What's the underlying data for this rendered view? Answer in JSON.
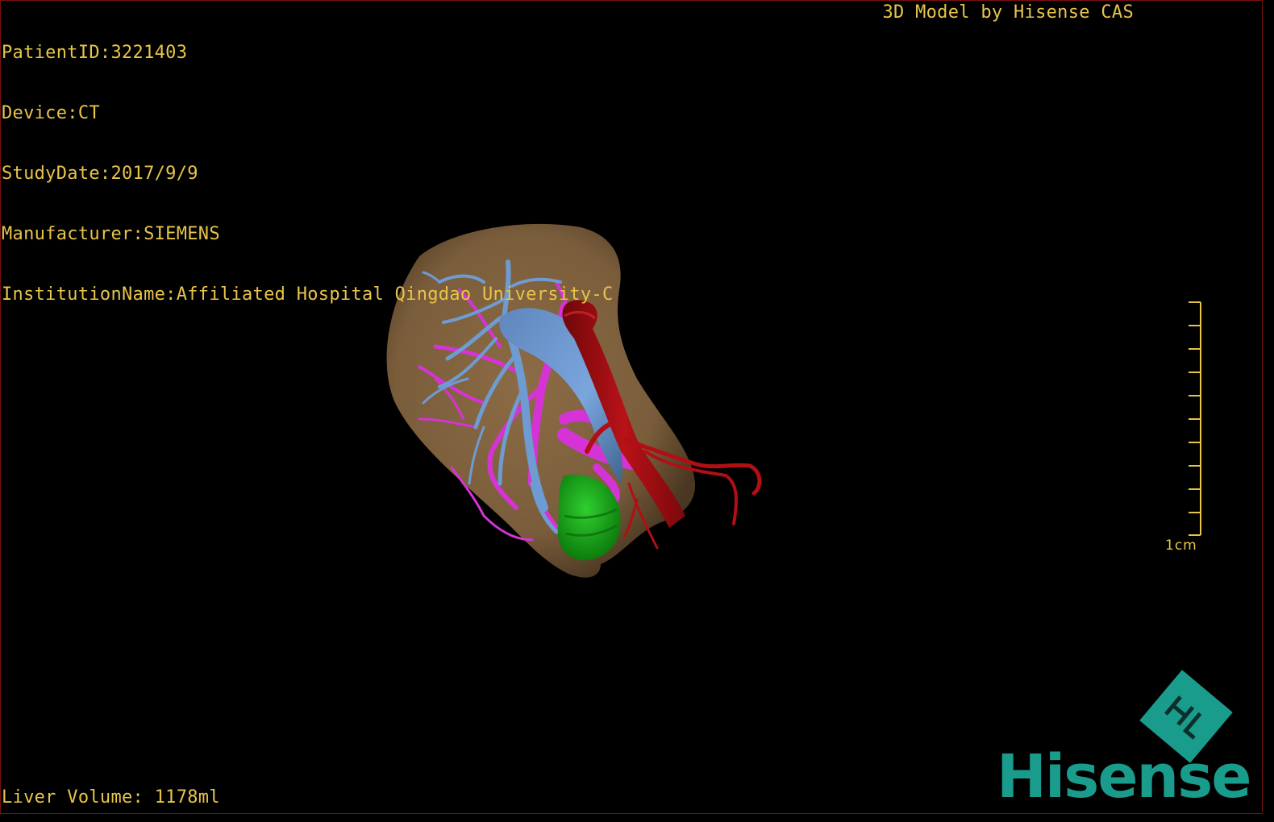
{
  "dicom_info": {
    "patient_id": "PatientID:3221403",
    "device": "Device:CT",
    "study_date": "StudyDate:2017/9/9",
    "manufacturer": "Manufacturer:SIEMENS",
    "institution": "InstitutionName:Affiliated Hospital Qingdao University-C"
  },
  "model_title": "3D Model by Hisense CAS",
  "liver_volume": "Liver Volume: 1178ml",
  "scale": {
    "label": "1cm"
  },
  "logo": {
    "brand": "Hisense"
  },
  "colors": {
    "overlay_text": "#e8c44a",
    "liver": "#7a5f3f",
    "portal_vein": "#6f9bd3",
    "hepatic_vein": "#d633d6",
    "artery": "#b10f14",
    "gallbladder": "#1fa61f",
    "brand": "#1a9c8c"
  }
}
